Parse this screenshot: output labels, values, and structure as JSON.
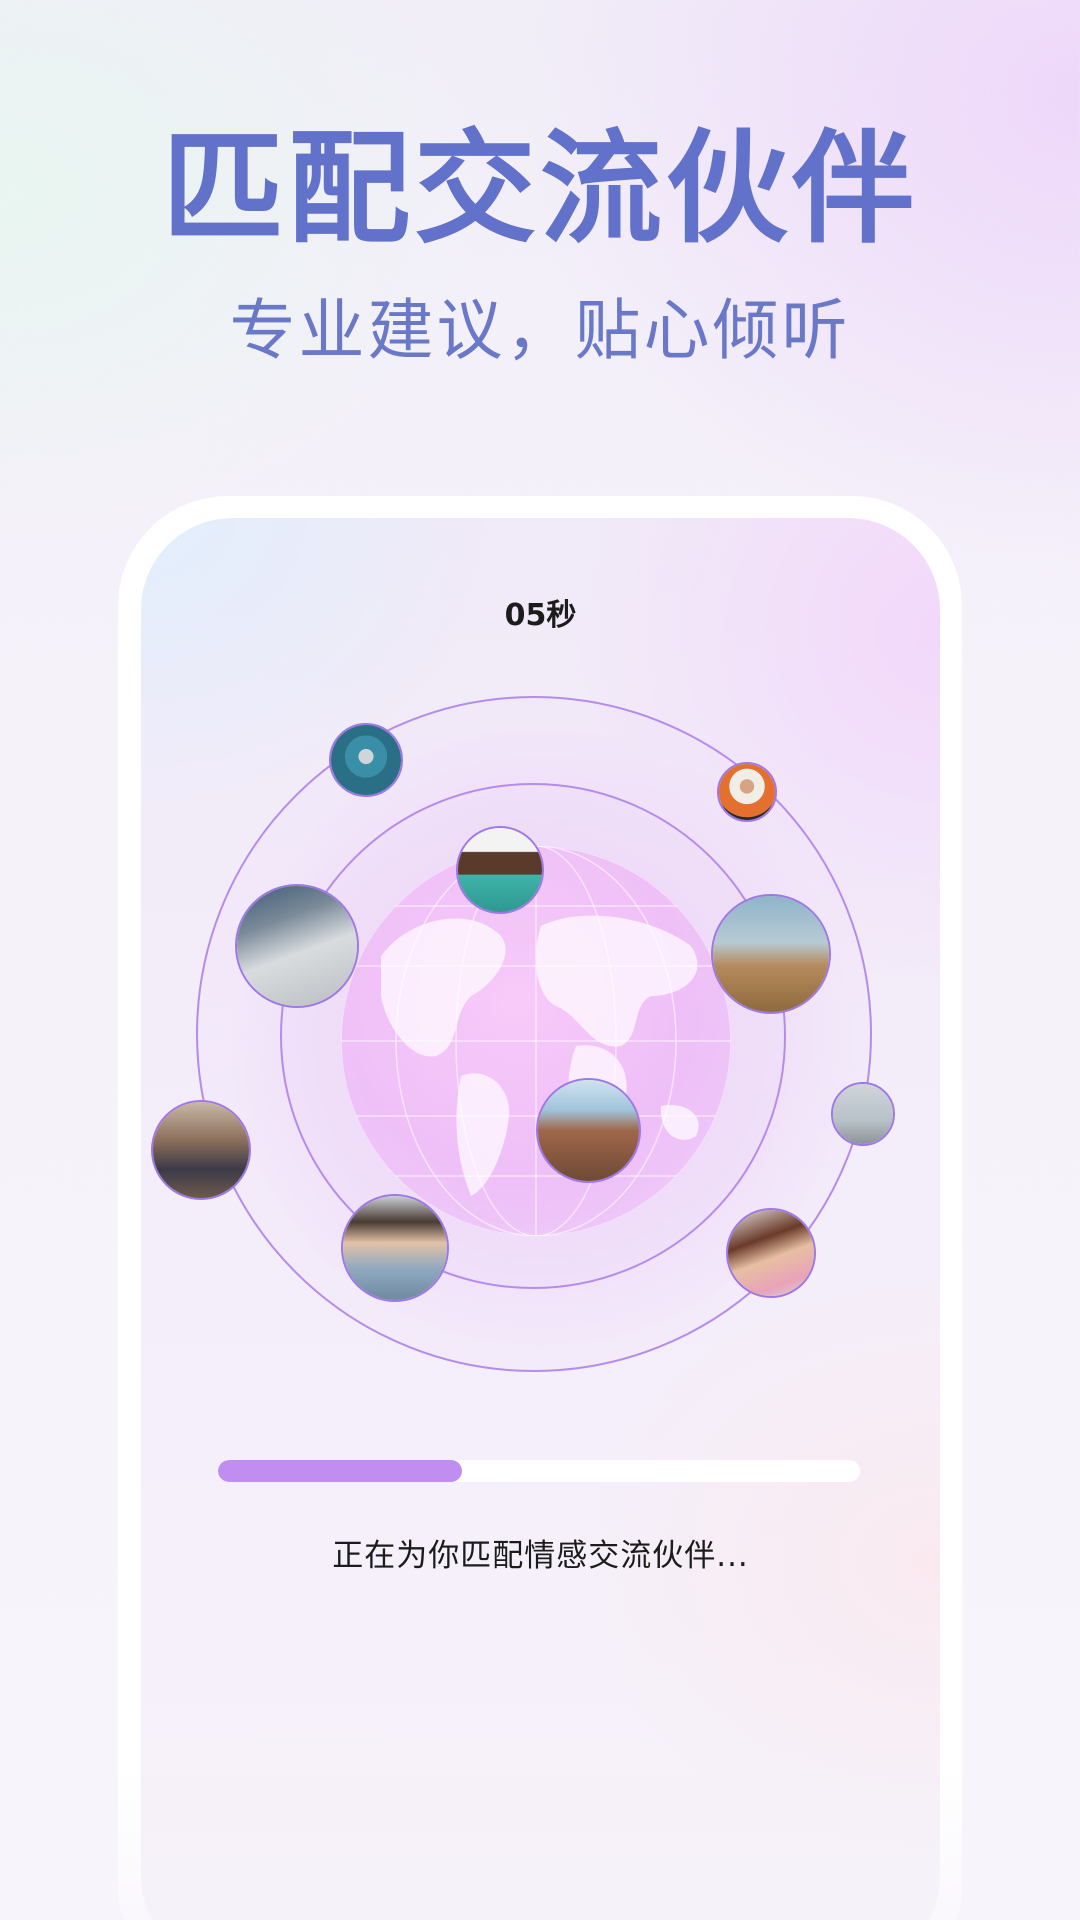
{
  "promo": {
    "headline": "匹配交流伙伴",
    "subheadline": "专业建议，贴心倾听"
  },
  "match_screen": {
    "timer": "05秒",
    "progress_fraction": 0.38,
    "status": "正在为你匹配情感交流伙伴..."
  },
  "colors": {
    "headline": "#6271c9",
    "ring": "#b58ceb",
    "progress_fill": "#bf8ef0",
    "globe_glow": "#f0a8f6"
  },
  "avatars": [
    {
      "id": "avatar-1",
      "icon": "person-photo"
    },
    {
      "id": "avatar-2",
      "icon": "person-photo"
    },
    {
      "id": "avatar-3",
      "icon": "person-photo"
    },
    {
      "id": "avatar-4",
      "icon": "street-art-photo"
    },
    {
      "id": "avatar-5",
      "icon": "person-in-field-photo"
    },
    {
      "id": "avatar-6",
      "icon": "canyon-photo"
    },
    {
      "id": "avatar-7",
      "icon": "person-photo"
    },
    {
      "id": "avatar-8",
      "icon": "group-walking-photo"
    },
    {
      "id": "avatar-9",
      "icon": "person-photo"
    },
    {
      "id": "avatar-10",
      "icon": "person-photo"
    }
  ]
}
